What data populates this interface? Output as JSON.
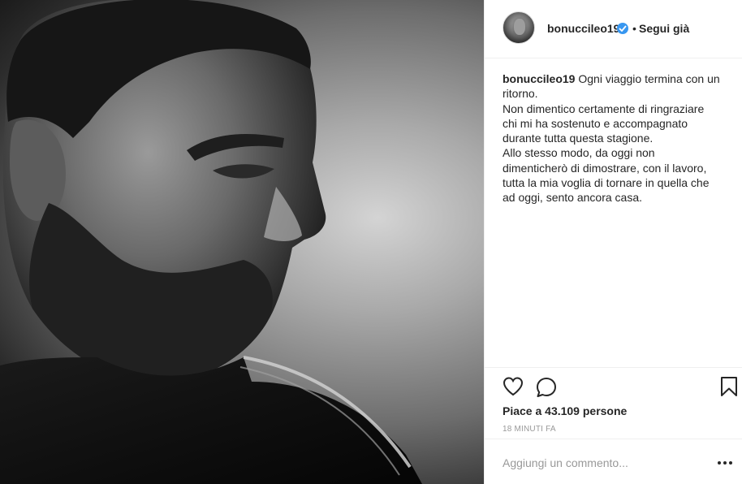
{
  "post": {
    "image_description_icon": "post-photo",
    "author": {
      "username": "bonuccileo19",
      "verified_icon": "verified-badge-icon",
      "separator": "•",
      "follow_label": "Segui già"
    },
    "caption": {
      "username": "bonuccileo19",
      "lines": [
        "Ogni viaggio termina con un",
        "ritorno.",
        "Non dimentico certamente di ringraziare",
        "chi mi ha sostenuto e accompagnato",
        "durante tutta questa stagione.",
        "Allo stesso modo, da oggi non",
        "dimenticherò di dimostrare, con il lavoro,",
        "tutta la mia voglia di tornare in quella che",
        "ad oggi, sento ancora casa."
      ]
    },
    "likes_text": "Piace a 43.109 persone",
    "timestamp": "18 minuti fa",
    "comment": {
      "placeholder": "Aggiungi un commento...",
      "value": ""
    },
    "colors": {
      "accent_blue": "#3897f0",
      "text": "#262626",
      "muted": "#999999",
      "border": "#efefef"
    }
  }
}
